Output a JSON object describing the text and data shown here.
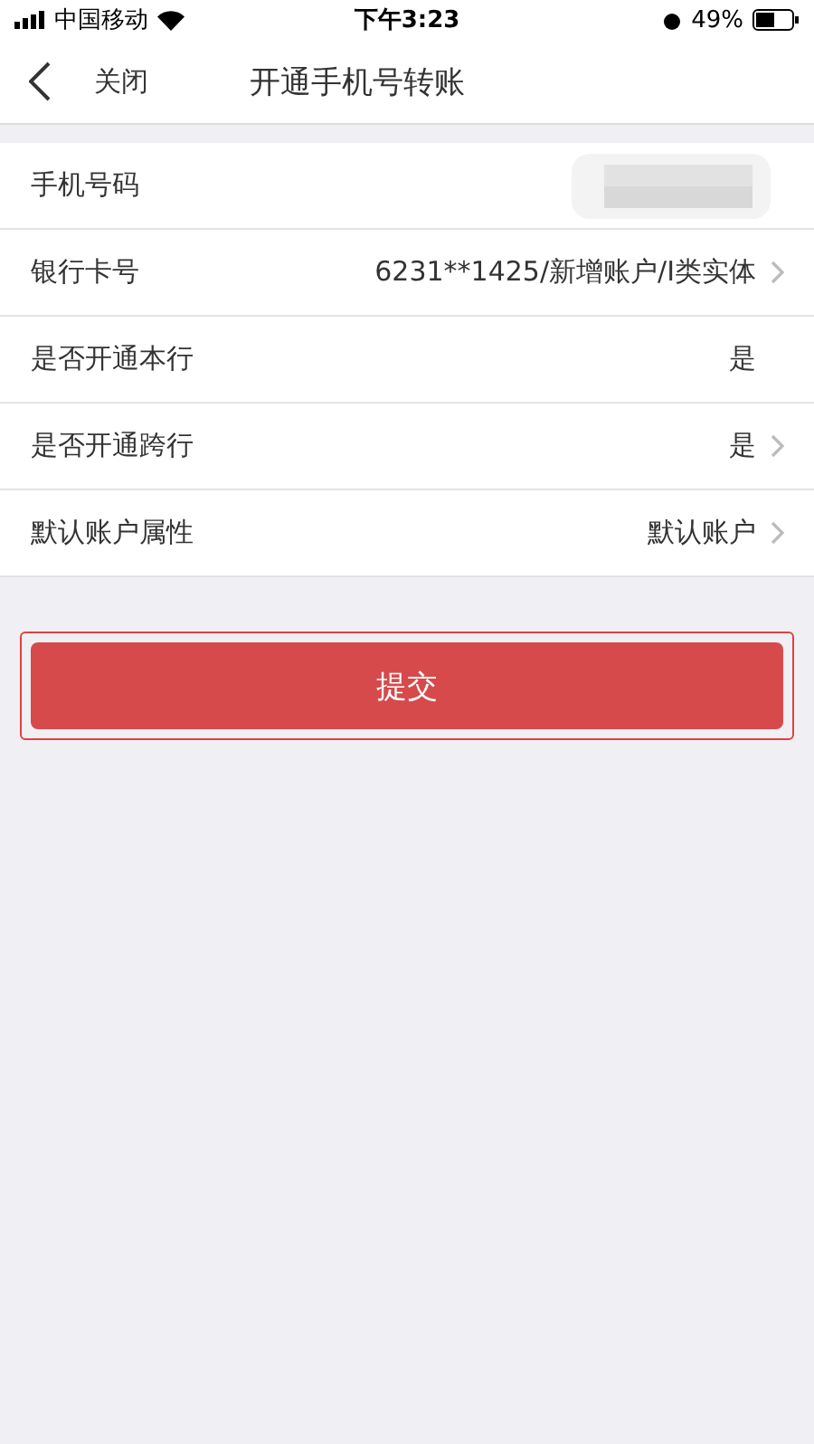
{
  "status_bar": {
    "carrier": "中国移动",
    "time": "下午3:23",
    "battery": "49%"
  },
  "nav": {
    "back": "关闭",
    "title": "开通手机号转账"
  },
  "rows": [
    {
      "label": "手机号码",
      "kind": "redacted",
      "chevron": false
    },
    {
      "label": "银行卡号",
      "value": "6231**1425/新增账户/I类实体",
      "kind": "text",
      "chevron": true
    },
    {
      "label": "是否开通本行",
      "value": "是",
      "kind": "text",
      "chevron": false
    },
    {
      "label": "是否开通跨行",
      "value": "是",
      "kind": "text",
      "chevron": true
    },
    {
      "label": "默认账户属性",
      "value": "默认账户",
      "kind": "text",
      "chevron": true
    }
  ],
  "submit": {
    "label": "提交",
    "highlighted": true
  }
}
